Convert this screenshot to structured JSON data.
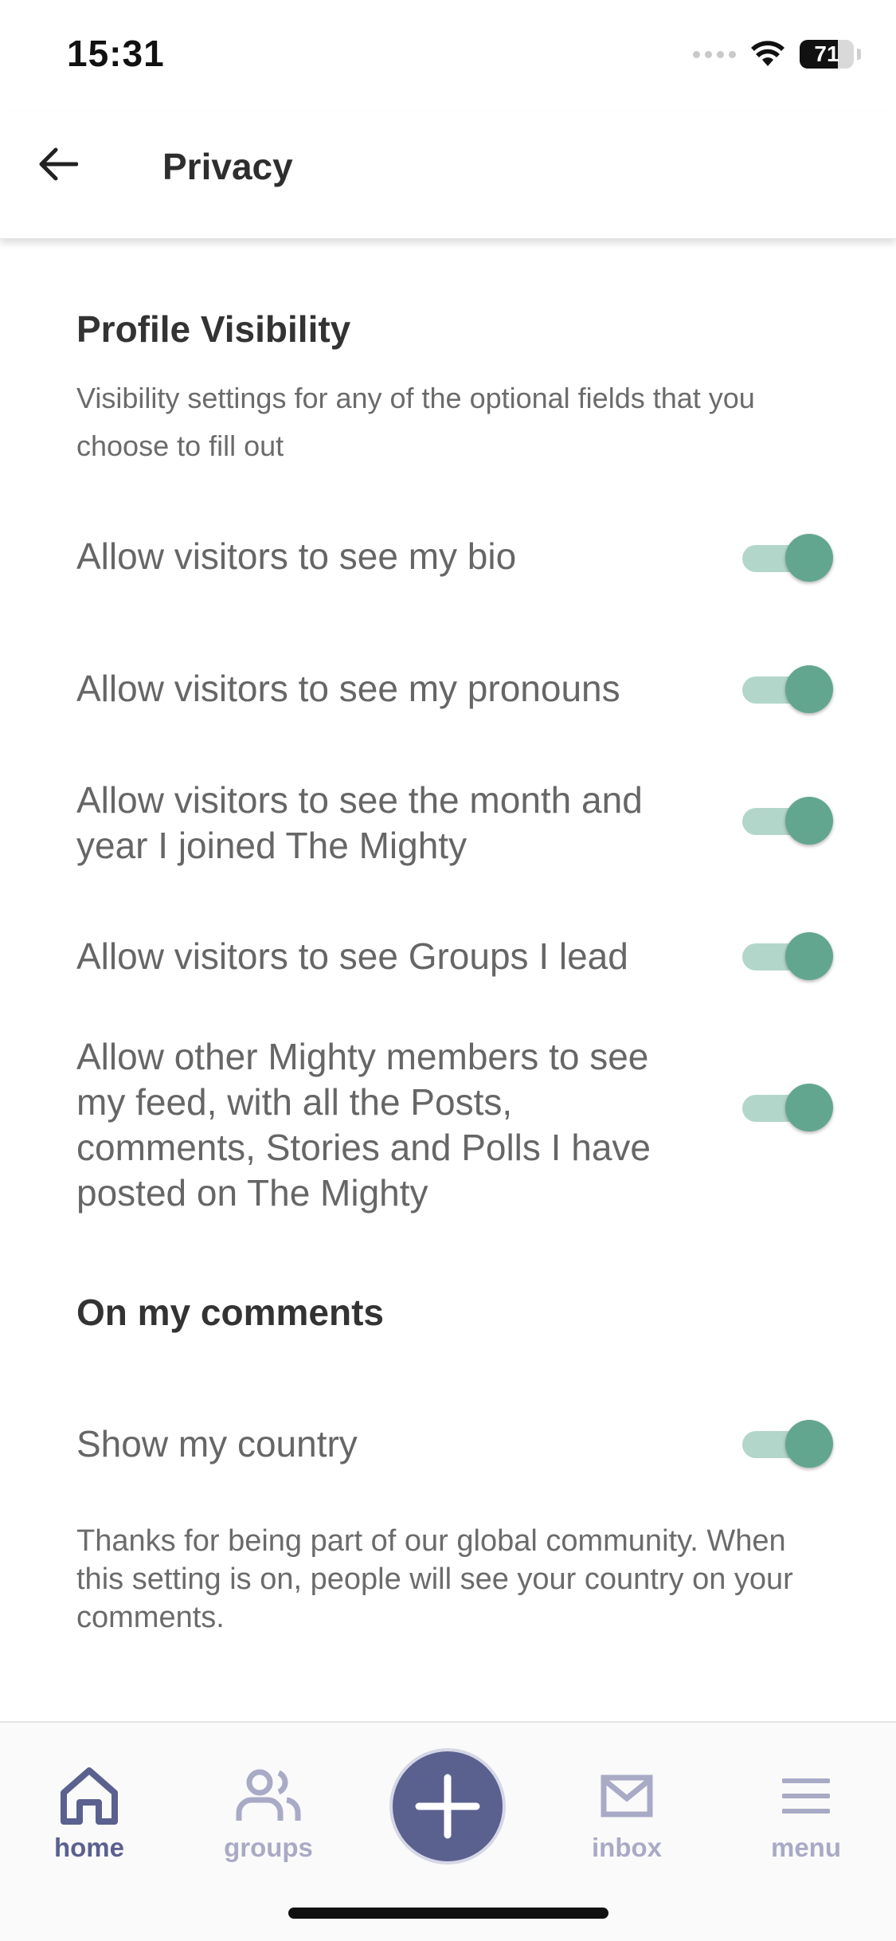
{
  "status_bar": {
    "time": "15:31",
    "battery": "71",
    "battery_level": 0.71,
    "icons": [
      "signal-dots-icon",
      "wifi-icon",
      "battery-icon"
    ]
  },
  "header": {
    "back_icon": "arrow-left-icon",
    "title": "Privacy"
  },
  "profile_visibility": {
    "title": "Profile Visibility",
    "description": "Visibility settings for any of the optional fields that you choose to fill out",
    "settings": [
      {
        "label": "Allow visitors to see my bio",
        "enabled": true
      },
      {
        "label": "Allow visitors to see my pronouns",
        "enabled": true
      },
      {
        "label": "Allow visitors to see the month and year I joined The Mighty",
        "enabled": true
      },
      {
        "label": "Allow visitors to see Groups I lead",
        "enabled": true
      },
      {
        "label": "Allow other Mighty members to see my feed, with all the Posts, comments, Stories and Polls I have posted on The Mighty",
        "enabled": true
      }
    ]
  },
  "comments_section": {
    "title": "On my comments",
    "setting": {
      "label": "Show my country",
      "enabled": true
    },
    "note": "Thanks for being part of our global community. When this setting is on, people will see your country on your comments."
  },
  "bottom_nav": {
    "items": [
      {
        "label": "home",
        "icon": "home-icon",
        "active": true
      },
      {
        "label": "groups",
        "icon": "groups-icon",
        "active": false
      },
      {
        "label": "",
        "icon": "plus-icon",
        "active": false
      },
      {
        "label": "inbox",
        "icon": "mail-icon",
        "active": false
      },
      {
        "label": "menu",
        "icon": "menu-icon",
        "active": false
      }
    ]
  },
  "colors": {
    "accent": "#5a618f",
    "toggle_on": "#62a690",
    "toggle_track": "#b3d6cb"
  }
}
